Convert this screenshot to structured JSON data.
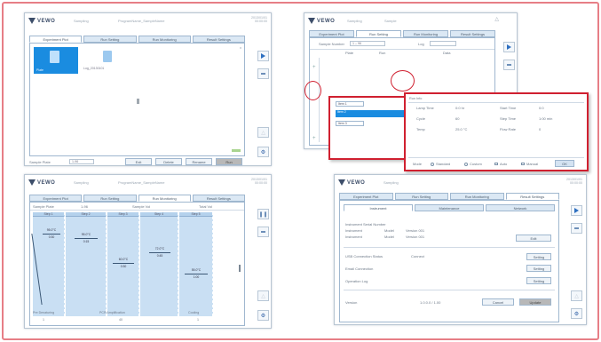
{
  "brand": "VEWO",
  "p1": {
    "hdr_left": "Sampling",
    "hdr_mid": "ProgramName_SampleName",
    "time": "2013/01/01\n00:00:00",
    "tabs": [
      "Experiment Plot",
      "Run Setting",
      "Run Monitoring",
      "Result Settings"
    ],
    "file1_label": "Plate",
    "file2_label": "Log_20130101",
    "footer_field_label": "Sample Plate",
    "footer_field_value": "1-96",
    "btns": [
      "Exit",
      "Delete",
      "Rename",
      "Run"
    ],
    "corner_badge": "x"
  },
  "p2": {
    "hdr_left": "Sampling",
    "hdr_mid": "Sample",
    "tabs": [
      "Experiment Plot",
      "Run Setting",
      "Run Monitoring",
      "Result Settings"
    ],
    "row_label": "Sample Number",
    "row_value": "1 – 96",
    "col_a": "Plate",
    "col_b": "Run",
    "col_c": "Log",
    "col_d": "Data",
    "list_items": [
      "Item 1",
      "Item 2",
      "Item 3"
    ],
    "popup_title": "Run Info",
    "popup_rows": [
      {
        "k": "Lamp Time",
        "v": "0:0 hr",
        "k2": "Start Time",
        "v2": "0:0"
      },
      {
        "k": "Cycle",
        "v": "60",
        "k2": "Step Time",
        "v2": "1:00 min"
      },
      {
        "k": "Temp",
        "v": "25.0 °C",
        "k2": "Flow Rate",
        "v2": "0"
      }
    ],
    "popup_footer": [
      "Mode",
      "Standard",
      "Custom",
      "Auto",
      "Manual"
    ],
    "popup_ok": "OK"
  },
  "p3": {
    "hdr_left": "Sampling",
    "hdr_mid": "ProgramName_SampleName",
    "time": "2013/01/01\n00:00:00",
    "tabs": [
      "Experiment Plot",
      "Run Setting",
      "Run Monitoring",
      "Result Settings"
    ],
    "info": [
      "Sample Plate",
      "1-96",
      "Sample Vol",
      "Total Vol"
    ],
    "steps": [
      "Step 1",
      "Step 2",
      "Step 3",
      "Step 4",
      "Step 5"
    ],
    "temps": [
      "95.0°C",
      "95.0°C",
      "60.0°C",
      "72.0°C",
      "55.0°C"
    ],
    "times": [
      "0:30",
      "0:15",
      "0:30",
      "0:45",
      "1:00"
    ],
    "footer": [
      "Pre Denaturing",
      "PCR Amplification",
      "Cooling"
    ],
    "footer_v": [
      "1",
      "40",
      "1"
    ]
  },
  "p4": {
    "hdr_left": "Sampling",
    "time": "2013/01/01\n00:00:00",
    "tabs": [
      "Experiment Plot",
      "Run Setting",
      "Run Monitoring",
      "Result Settings"
    ],
    "subtabs": [
      "Instrument",
      "Maintenance",
      "Network"
    ],
    "rows": [
      {
        "k": "Instrument Serial Number",
        "v": ""
      },
      {
        "k": "Instrument",
        "v": "Model",
        "v2": "Version 001"
      },
      {
        "k": "Instrument",
        "v": "Model",
        "v2": "Version 001"
      }
    ],
    "btn_edit": "Edit",
    "rows2": [
      "USB Connection Status",
      "Email Connection",
      "Operation Log"
    ],
    "rows2_v": [
      "Connect",
      "",
      ""
    ],
    "btn_setting": [
      "Setting",
      "Setting",
      "Setting"
    ],
    "version_label": "Version",
    "version_value": "1.0.0.0 / 1.00",
    "btn_cancel": "Cancel",
    "btn_save": "Update"
  }
}
